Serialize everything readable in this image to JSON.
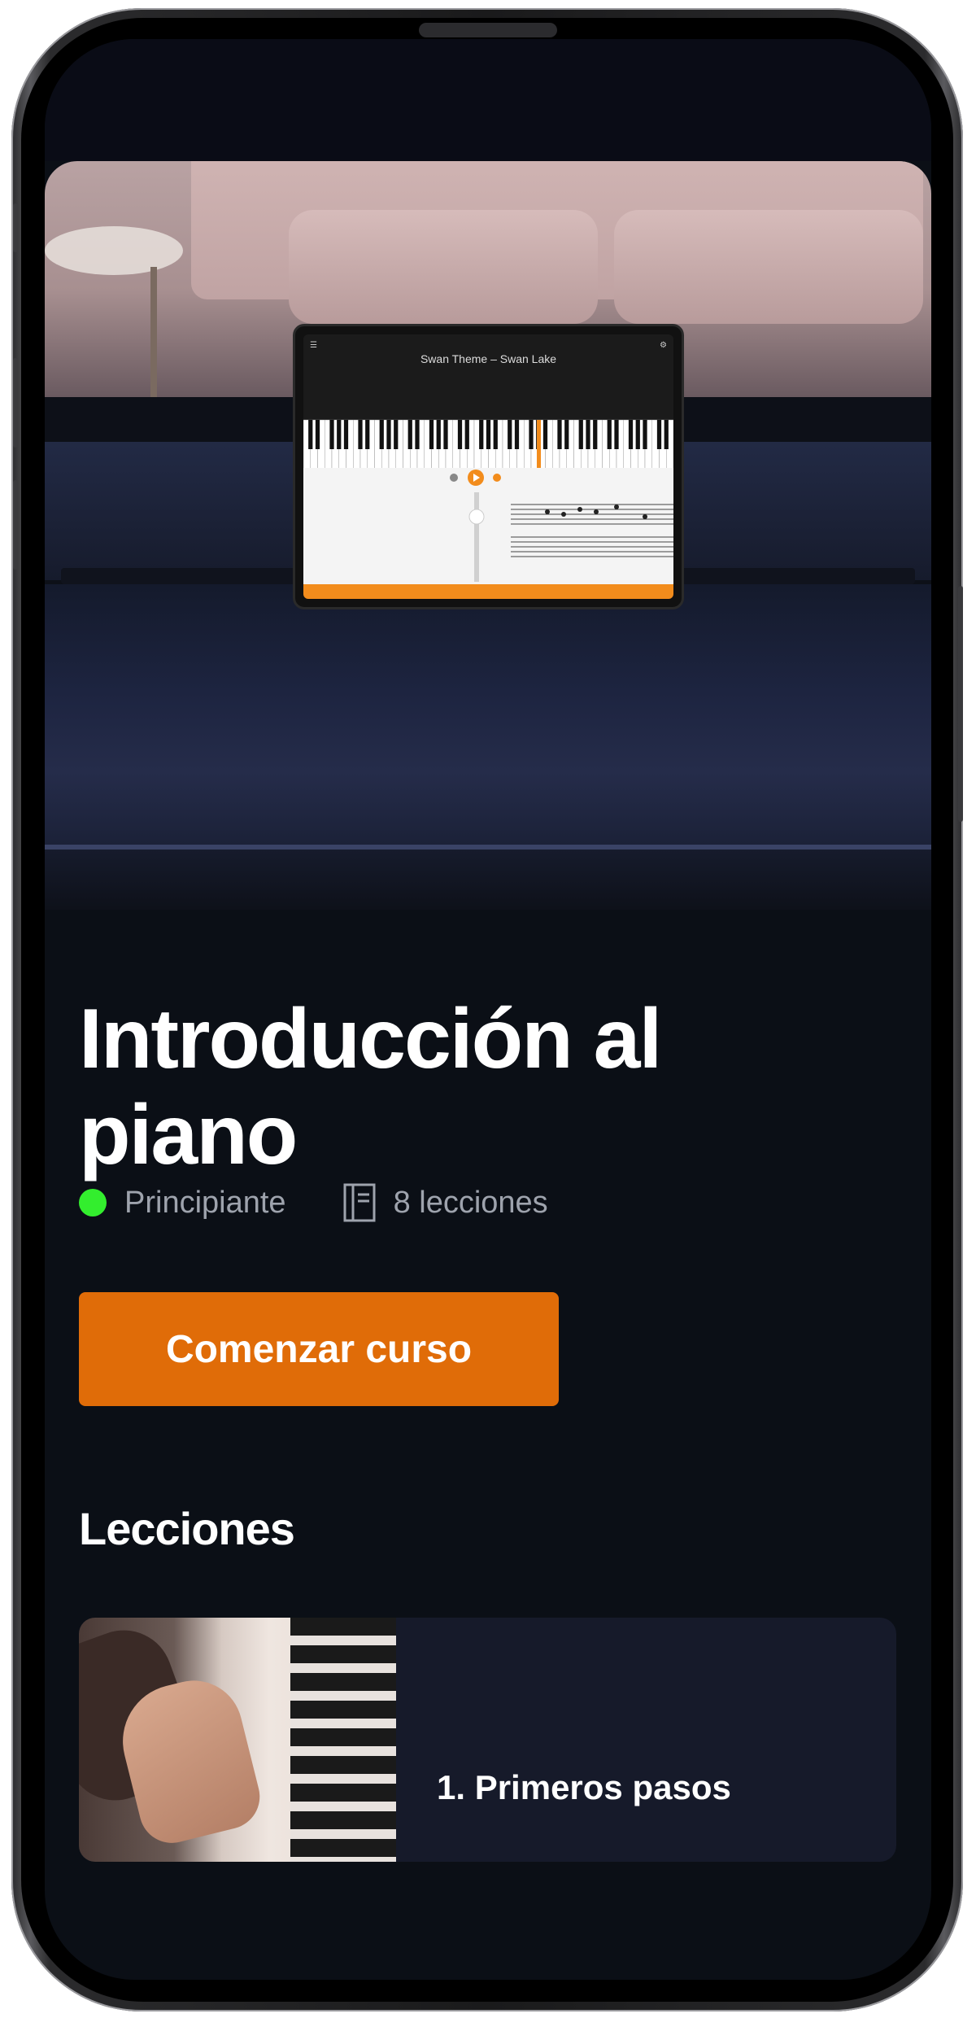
{
  "course": {
    "title": "Introducción al piano",
    "level": "Principiante",
    "lessons_count": "8 lecciones",
    "start_button": "Comenzar curso"
  },
  "hero": {
    "tablet_song": "Swan Theme – Swan Lake"
  },
  "lessons_section": {
    "title": "Lecciones",
    "items": [
      {
        "label": "1. Primeros pasos"
      }
    ]
  },
  "colors": {
    "accent": "#e06c08",
    "level_dot": "#33ee2e",
    "background": "#0b0f16"
  },
  "icons": {
    "level": "green-dot-icon",
    "lessons": "book-icon"
  }
}
